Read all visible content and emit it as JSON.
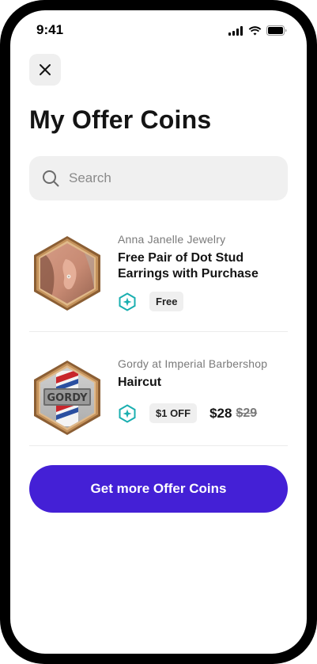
{
  "status_bar": {
    "time": "9:41"
  },
  "header": {
    "close_icon": "close-icon",
    "title": "My Offer Coins"
  },
  "search": {
    "placeholder": "Search",
    "value": ""
  },
  "offers": [
    {
      "merchant": "Anna Janelle Jewelry",
      "title": "Free Pair of Dot Stud Earrings with Purchase",
      "discount_label": "Free",
      "image": "earring-photo"
    },
    {
      "merchant": "Gordy at Imperial Barbershop",
      "title": "Haircut",
      "discount_label": "$1 OFF",
      "price": "$28",
      "original_price": "$29",
      "image": "barbershop-logo",
      "logo_text": "GORDY"
    }
  ],
  "cta": {
    "label": "Get more Offer Coins"
  },
  "colors": {
    "accent": "#4420D6",
    "coin": "#1AAFB0",
    "badge_ring": "#C4925B"
  }
}
